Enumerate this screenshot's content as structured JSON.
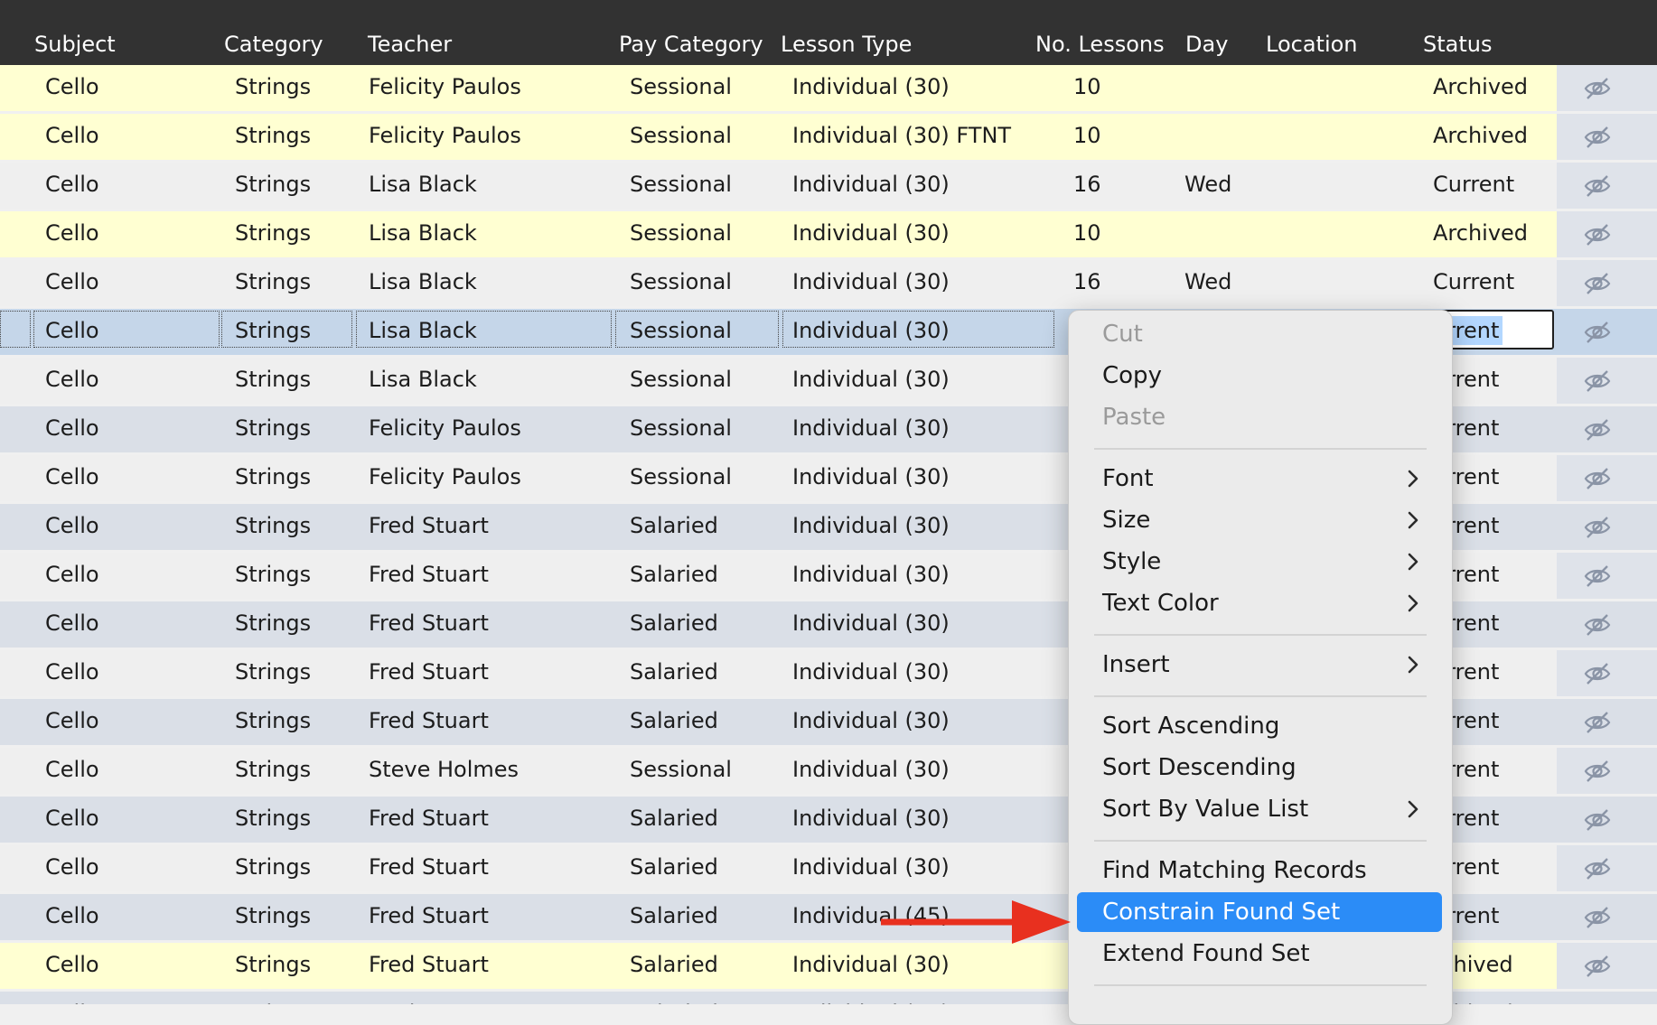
{
  "columns": [
    {
      "key": "subject",
      "label": "Subject"
    },
    {
      "key": "category",
      "label": "Category"
    },
    {
      "key": "teacher",
      "label": "Teacher"
    },
    {
      "key": "pay_category",
      "label": "Pay Category"
    },
    {
      "key": "lesson_type",
      "label": "Lesson Type"
    },
    {
      "key": "no_lessons",
      "label": "No. Lessons"
    },
    {
      "key": "day",
      "label": "Day"
    },
    {
      "key": "location",
      "label": "Location"
    },
    {
      "key": "status",
      "label": "Status"
    }
  ],
  "rows": [
    {
      "subject": "Cello",
      "category": "Strings",
      "teacher": "Felicity Paulos",
      "pay_category": "Sessional",
      "lesson_type": "Individual (30)",
      "no_lessons": "10",
      "day": "",
      "location": "",
      "status": "Archived",
      "tint": "archived"
    },
    {
      "subject": "Cello",
      "category": "Strings",
      "teacher": "Felicity Paulos",
      "pay_category": "Sessional",
      "lesson_type": "Individual (30) FTNT",
      "no_lessons": "10",
      "day": "",
      "location": "",
      "status": "Archived",
      "tint": "archived"
    },
    {
      "subject": "Cello",
      "category": "Strings",
      "teacher": "Lisa Black",
      "pay_category": "Sessional",
      "lesson_type": "Individual (30)",
      "no_lessons": "16",
      "day": "Wed",
      "location": "",
      "status": "Current",
      "tint": "light"
    },
    {
      "subject": "Cello",
      "category": "Strings",
      "teacher": "Lisa Black",
      "pay_category": "Sessional",
      "lesson_type": "Individual (30)",
      "no_lessons": "10",
      "day": "",
      "location": "",
      "status": "Archived",
      "tint": "archived"
    },
    {
      "subject": "Cello",
      "category": "Strings",
      "teacher": "Lisa Black",
      "pay_category": "Sessional",
      "lesson_type": "Individual (30)",
      "no_lessons": "16",
      "day": "Wed",
      "location": "",
      "status": "Current",
      "tint": "light"
    },
    {
      "subject": "Cello",
      "category": "Strings",
      "teacher": "Lisa Black",
      "pay_category": "Sessional",
      "lesson_type": "Individual (30)",
      "no_lessons": "",
      "day": "",
      "location": "",
      "status": "urrent",
      "tint": "selected",
      "selected": true
    },
    {
      "subject": "Cello",
      "category": "Strings",
      "teacher": "Lisa Black",
      "pay_category": "Sessional",
      "lesson_type": "Individual (30)",
      "no_lessons": "",
      "day": "",
      "location": "",
      "status": "urrent",
      "tint": "light"
    },
    {
      "subject": "Cello",
      "category": "Strings",
      "teacher": "Felicity Paulos",
      "pay_category": "Sessional",
      "lesson_type": "Individual (30)",
      "no_lessons": "",
      "day": "",
      "location": "",
      "status": "urrent",
      "tint": "blue"
    },
    {
      "subject": "Cello",
      "category": "Strings",
      "teacher": "Felicity Paulos",
      "pay_category": "Sessional",
      "lesson_type": "Individual (30)",
      "no_lessons": "",
      "day": "",
      "location": "",
      "status": "urrent",
      "tint": "light"
    },
    {
      "subject": "Cello",
      "category": "Strings",
      "teacher": "Fred Stuart",
      "pay_category": "Salaried",
      "lesson_type": "Individual (30)",
      "no_lessons": "",
      "day": "",
      "location": "",
      "status": "urrent",
      "tint": "blue"
    },
    {
      "subject": "Cello",
      "category": "Strings",
      "teacher": "Fred Stuart",
      "pay_category": "Salaried",
      "lesson_type": "Individual (30)",
      "no_lessons": "",
      "day": "",
      "location": "",
      "status": "urrent",
      "tint": "light"
    },
    {
      "subject": "Cello",
      "category": "Strings",
      "teacher": "Fred Stuart",
      "pay_category": "Salaried",
      "lesson_type": "Individual (30)",
      "no_lessons": "",
      "day": "",
      "location": "",
      "status": "urrent",
      "tint": "blue"
    },
    {
      "subject": "Cello",
      "category": "Strings",
      "teacher": "Fred Stuart",
      "pay_category": "Salaried",
      "lesson_type": "Individual (30)",
      "no_lessons": "",
      "day": "",
      "location": "",
      "status": "urrent",
      "tint": "light"
    },
    {
      "subject": "Cello",
      "category": "Strings",
      "teacher": "Fred Stuart",
      "pay_category": "Salaried",
      "lesson_type": "Individual (30)",
      "no_lessons": "",
      "day": "",
      "location": "",
      "status": "urrent",
      "tint": "blue"
    },
    {
      "subject": "Cello",
      "category": "Strings",
      "teacher": "Steve Holmes",
      "pay_category": "Sessional",
      "lesson_type": "Individual (30)",
      "no_lessons": "",
      "day": "",
      "location": "",
      "status": "urrent",
      "tint": "light"
    },
    {
      "subject": "Cello",
      "category": "Strings",
      "teacher": "Fred Stuart",
      "pay_category": "Salaried",
      "lesson_type": "Individual (30)",
      "no_lessons": "",
      "day": "",
      "location": "",
      "status": "urrent",
      "tint": "blue"
    },
    {
      "subject": "Cello",
      "category": "Strings",
      "teacher": "Fred Stuart",
      "pay_category": "Salaried",
      "lesson_type": "Individual (30)",
      "no_lessons": "",
      "day": "",
      "location": "",
      "status": "urrent",
      "tint": "light"
    },
    {
      "subject": "Cello",
      "category": "Strings",
      "teacher": "Fred Stuart",
      "pay_category": "Salaried",
      "lesson_type": "Individual (45)",
      "no_lessons": "",
      "day": "",
      "location": "",
      "status": "urrent",
      "tint": "blue"
    },
    {
      "subject": "Cello",
      "category": "Strings",
      "teacher": "Fred Stuart",
      "pay_category": "Salaried",
      "lesson_type": "Individual (30)",
      "no_lessons": "",
      "day": "",
      "location": "",
      "status": "rchived",
      "tint": "archived"
    },
    {
      "subject": "Cello",
      "category": "Strings",
      "teacher": "Fred Stuart",
      "pay_category": "Salaried",
      "lesson_type": "Individual (30)",
      "no_lessons": "",
      "day": "",
      "location": "",
      "status": "rchived",
      "tint": "blue"
    }
  ],
  "row_icon": "eye-slash-icon",
  "context_menu": {
    "items": [
      {
        "label": "Cut",
        "disabled": true
      },
      {
        "label": "Copy"
      },
      {
        "label": "Paste",
        "disabled": true
      },
      {
        "separator": true
      },
      {
        "label": "Font",
        "submenu": true
      },
      {
        "label": "Size",
        "submenu": true
      },
      {
        "label": "Style",
        "submenu": true
      },
      {
        "label": "Text Color",
        "submenu": true
      },
      {
        "separator": true
      },
      {
        "label": "Insert",
        "submenu": true
      },
      {
        "separator": true
      },
      {
        "label": "Sort Ascending"
      },
      {
        "label": "Sort Descending"
      },
      {
        "label": "Sort By Value List",
        "submenu": true
      },
      {
        "separator": true
      },
      {
        "label": "Find Matching Records"
      },
      {
        "label": "Constrain Found Set",
        "highlighted": true
      },
      {
        "label": "Extend Found Set"
      },
      {
        "separator": true
      }
    ]
  },
  "colors": {
    "header_bg": "#323232",
    "archived_row": "#ffffd2",
    "light_row": "#efefef",
    "blue_row": "#dadfe7",
    "selected_row": "#c5d6e9",
    "menu_highlight": "#2b8cf7",
    "annotation_arrow": "#e8301f"
  }
}
